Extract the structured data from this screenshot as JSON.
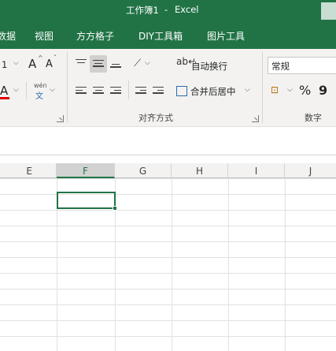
{
  "titlebar": {
    "workbook": "工作簿1",
    "separator": "-",
    "app": "Excel"
  },
  "tabs": [
    {
      "label": "数据"
    },
    {
      "label": "视图"
    },
    {
      "label": "方方格子"
    },
    {
      "label": "DIY工具箱"
    },
    {
      "label": "图片工具"
    }
  ],
  "ribbon": {
    "font_size_value": "1",
    "grow_font_glyph": "A",
    "shrink_font_glyph": "A",
    "font_color_glyph": "A",
    "phonetic_top": "wén",
    "phonetic_bottom": "文",
    "wrap_text_label": "自动换行",
    "merge_center_label": "合并后居中",
    "alignment_group_label": "对齐方式",
    "number_format_value": "常规",
    "percent_glyph": "%",
    "comma_glyph": "9",
    "number_group_label": "数字"
  },
  "columns": [
    {
      "label": "E",
      "active": false
    },
    {
      "label": "F",
      "active": true
    },
    {
      "label": "G",
      "active": false
    },
    {
      "label": "H",
      "active": false
    },
    {
      "label": "I",
      "active": false
    },
    {
      "label": "J",
      "active": false
    }
  ],
  "colors": {
    "brand": "#217346",
    "ribbon_bg": "#f3f2f1",
    "font_color_bar": "#e00000",
    "gridline": "#e1e1e1"
  }
}
